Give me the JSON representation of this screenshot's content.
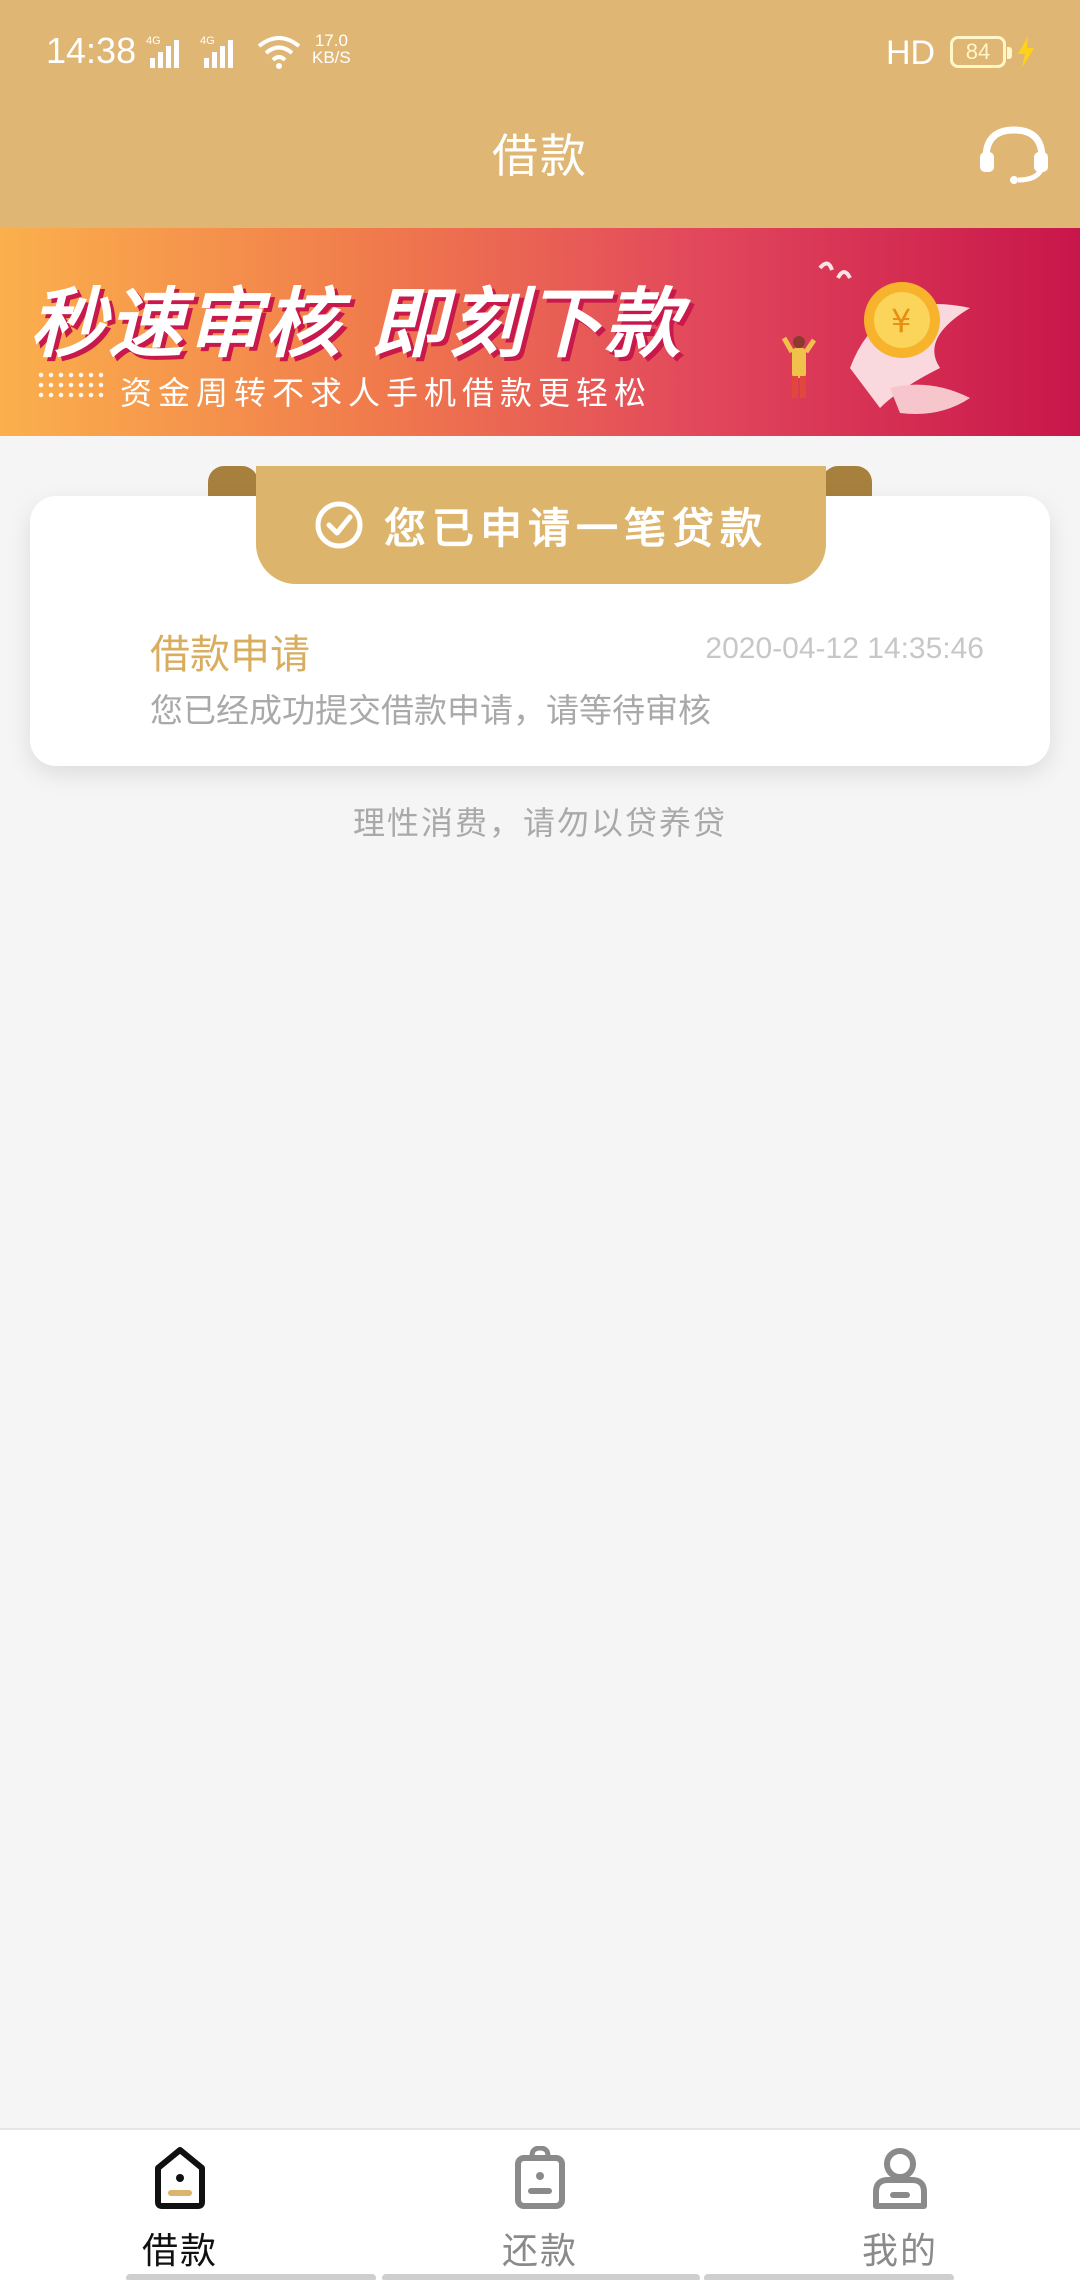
{
  "status_bar": {
    "time": "14:38",
    "network_1": "4G",
    "network_2": "4G",
    "speed_value": "17.0",
    "speed_unit": "KB/S",
    "hd": "HD",
    "battery": "84"
  },
  "header": {
    "title": "借款",
    "background": "#dfb673"
  },
  "banner": {
    "headline": "秒速审核 即刻下款",
    "subline": "资金周转不求人手机借款更轻松"
  },
  "card": {
    "ribbon_text": "您已申请一笔贷款",
    "apply_title": "借款申请",
    "apply_time": "2020-04-12 14:35:46",
    "apply_desc": "您已经成功提交借款申请，请等待审核"
  },
  "notice": "理性消费，请勿以贷养贷",
  "tabs": [
    {
      "label": "借款",
      "icon": "borrow-icon",
      "active": true
    },
    {
      "label": "还款",
      "icon": "repay-icon",
      "active": false
    },
    {
      "label": "我的",
      "icon": "profile-icon",
      "active": false
    }
  ],
  "colors": {
    "accent": "#dcb46c",
    "title_gold": "#d9ad5f",
    "muted": "#a9a9a9"
  }
}
